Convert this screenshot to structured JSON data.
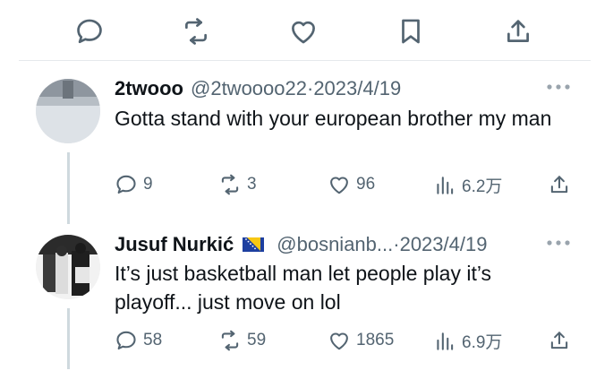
{
  "replies": [
    {
      "name": "2twooo",
      "handle": "@2twoooo22",
      "separator": "·",
      "date": "2023/4/19",
      "text": "Gotta stand with your european brother my man",
      "metrics": {
        "replies": "9",
        "reposts": "3",
        "likes": "96",
        "views": "6.2万"
      }
    },
    {
      "name": "Jusuf Nurkić",
      "handle": "@bosnianb...",
      "separator": "·",
      "date": "2023/4/19",
      "text": "It’s just basketball man let people play it’s playoff...  just move on lol",
      "metrics": {
        "replies": "58",
        "reposts": "59",
        "likes": "1865",
        "views": "6.9万"
      }
    }
  ],
  "icons": {
    "reply": "chat-bubble-icon",
    "repost": "repost-icon",
    "like": "heart-icon",
    "bookmark": "bookmark-icon",
    "share": "share-icon",
    "views": "bar-chart-icon",
    "more": "more-dots-icon",
    "flag": "bosnia-flag-icon"
  },
  "colors": {
    "text": "#0f1419",
    "secondary": "#536471",
    "divider": "#e6e9ec",
    "thread": "#cfd9de"
  }
}
